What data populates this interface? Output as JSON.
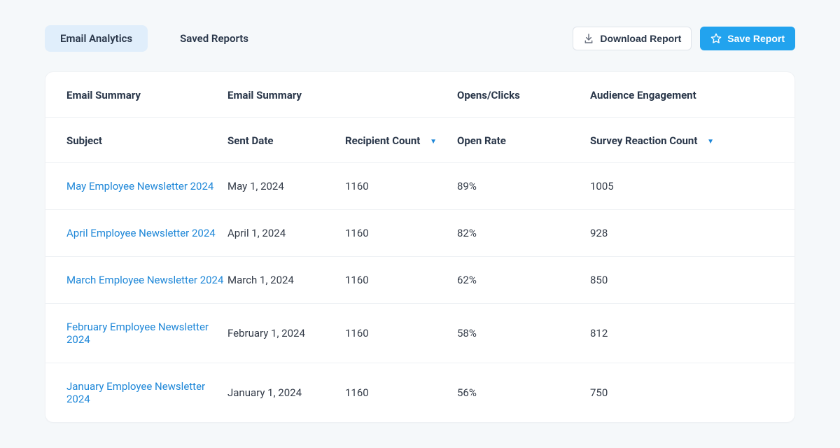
{
  "tabs": {
    "email_analytics": "Email Analytics",
    "saved_reports": "Saved Reports"
  },
  "buttons": {
    "download": "Download Report",
    "save": "Save Report"
  },
  "group_headers": {
    "g1": "Email Summary",
    "g2": "Email Summary",
    "g3": "Opens/Clicks",
    "g4": "Audience Engagement"
  },
  "columns": {
    "subject": "Subject",
    "sent_date": "Sent Date",
    "recipient_count": "Recipient Count",
    "open_rate": "Open Rate",
    "reaction_count": "Survey Reaction Count"
  },
  "rows": [
    {
      "subject": "May Employee Newsletter 2024",
      "sent_date": "May 1, 2024",
      "recipient_count": "1160",
      "open_rate": "89%",
      "reaction_count": "1005"
    },
    {
      "subject": "April Employee Newsletter 2024",
      "sent_date": "April 1, 2024",
      "recipient_count": "1160",
      "open_rate": "82%",
      "reaction_count": "928"
    },
    {
      "subject": "March Employee Newsletter 2024",
      "sent_date": "March 1, 2024",
      "recipient_count": "1160",
      "open_rate": "62%",
      "reaction_count": "850"
    },
    {
      "subject": "February Employee Newsletter 2024",
      "sent_date": "February 1, 2024",
      "recipient_count": "1160",
      "open_rate": "58%",
      "reaction_count": "812"
    },
    {
      "subject": "January Employee Newsletter 2024",
      "sent_date": "January 1, 2024",
      "recipient_count": "1160",
      "open_rate": "56%",
      "reaction_count": "750"
    }
  ]
}
